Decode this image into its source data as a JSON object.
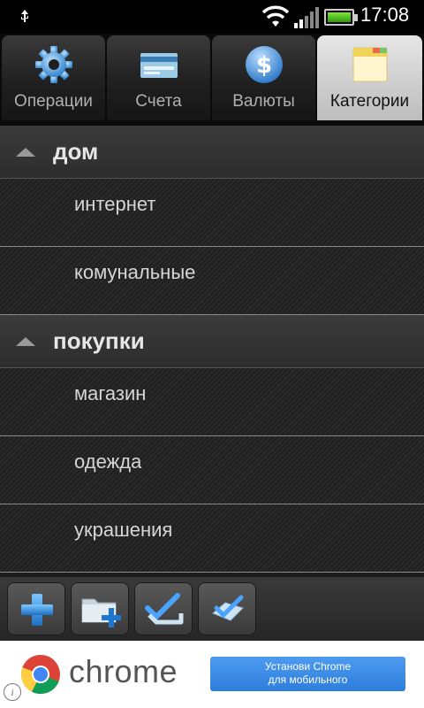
{
  "status_bar": {
    "time": "17:08",
    "icons": [
      "usb-icon",
      "wifi-icon",
      "signal-icon",
      "battery-icon"
    ],
    "battery_color": "#3fb51a"
  },
  "tabs": [
    {
      "label": "Операции",
      "icon": "gear-icon",
      "active": false
    },
    {
      "label": "Счета",
      "icon": "credit-card-icon",
      "active": false
    },
    {
      "label": "Валюты",
      "icon": "dollar-icon",
      "active": false
    },
    {
      "label": "Категории",
      "icon": "folder-icon",
      "active": true
    }
  ],
  "groups": [
    {
      "title": "дом",
      "items": [
        "интернет",
        "комунальные"
      ]
    },
    {
      "title": "покупки",
      "items": [
        "магазин",
        "одежда",
        "украшения"
      ]
    }
  ],
  "toolbar": {
    "buttons": [
      "add-icon",
      "add-folder-icon",
      "check-all-icon",
      "uncheck-all-icon"
    ]
  },
  "ad": {
    "brand": "chrome",
    "cta_line1": "Установи Chrome",
    "cta_line2": "для мобильного",
    "info_glyph": "i"
  },
  "colors": {
    "accent": "#2d7ddc",
    "active_tab": "#d4d4d4"
  }
}
